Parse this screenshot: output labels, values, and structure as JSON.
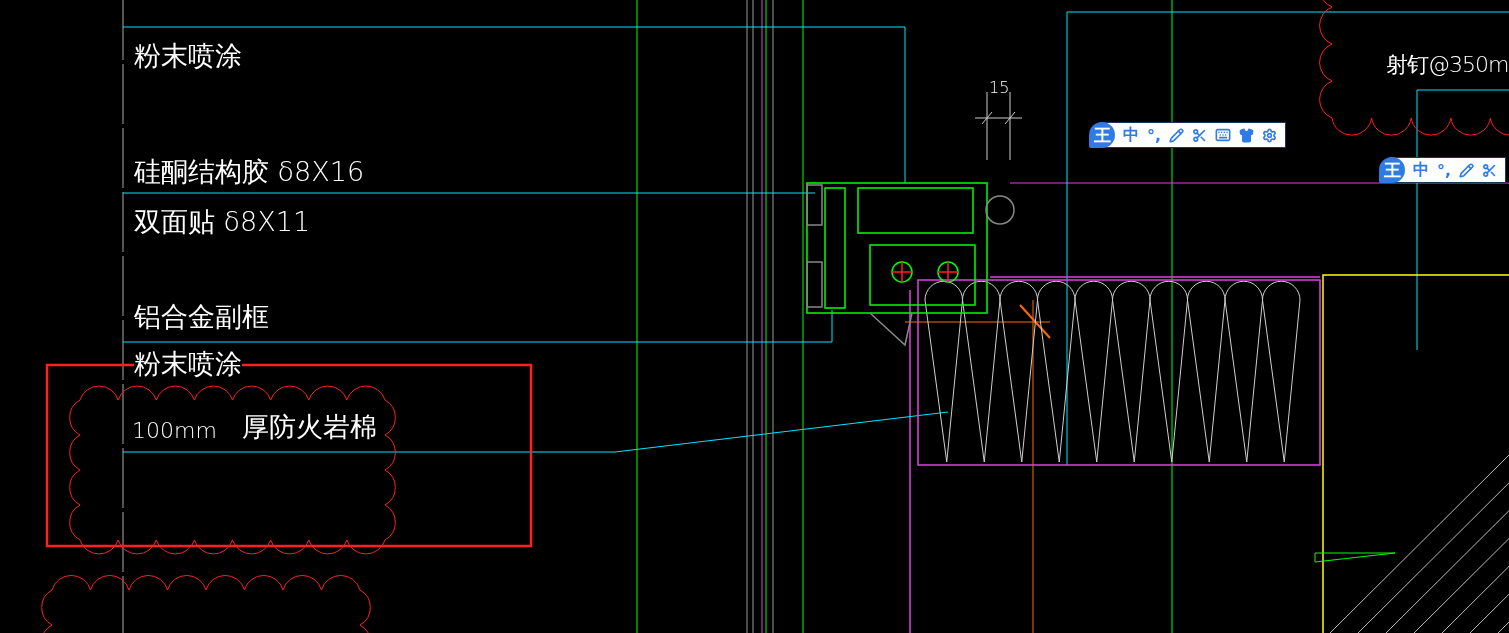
{
  "labels": [
    {
      "text": "粉末喷涂",
      "kind": "main"
    },
    {
      "text": "硅酮结构胶 δ8X16",
      "kind": "main"
    },
    {
      "text": "双面贴 δ8X11",
      "kind": "main"
    },
    {
      "text": "铝合金副框",
      "kind": "main"
    },
    {
      "text": "粉末喷涂",
      "kind": "main"
    },
    {
      "text": "100mm",
      "kind": "small"
    },
    {
      "text": "厚防火岩棉",
      "kind": "main"
    },
    {
      "text": "射钉@350m",
      "kind": "edge"
    }
  ],
  "dimension": {
    "text": "15"
  },
  "ime_toolbars": [
    {
      "logo": "王",
      "mode": "中",
      "punctuation": "°,",
      "items": [
        {
          "kind": "pen"
        },
        {
          "kind": "scissors"
        },
        {
          "kind": "keyboard"
        },
        {
          "kind": "shirt"
        },
        {
          "kind": "gear"
        }
      ]
    },
    {
      "logo": "王",
      "mode": "中",
      "punctuation": "°,",
      "items": [
        {
          "kind": "pen"
        },
        {
          "kind": "scissors"
        }
      ]
    }
  ]
}
